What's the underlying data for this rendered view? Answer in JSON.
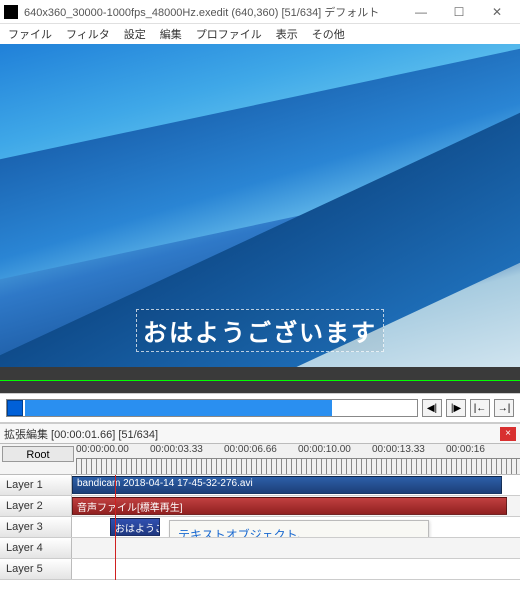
{
  "titlebar": {
    "title": "640x360_30000-1000fps_48000Hz.exedit (640,360) [51/634] デフォルト",
    "min": "—",
    "max": "☐",
    "close": "✕"
  },
  "menubar": [
    "ファイル",
    "フィルタ",
    "設定",
    "編集",
    "プロファイル",
    "表示",
    "その他"
  ],
  "preview_text": "おはようございます",
  "nav": {
    "a": "◀|",
    "b": "|▶",
    "c": "|←",
    "d": "→|"
  },
  "timeline": {
    "title": "拡張編集 [00:00:01.66] [51/634]",
    "close": "×",
    "root": "Root",
    "ticks": [
      "00:00:00.00",
      "00:00:03.33",
      "00:00:06.66",
      "00:00:10.00",
      "00:00:13.33",
      "00:00:16"
    ],
    "layers": [
      "Layer 1",
      "Layer 2",
      "Layer 3",
      "Layer 4",
      "Layer 5"
    ],
    "clip_video": "bandicam 2018-04-14 17-45-32-276.avi",
    "clip_audio": "音声ファイル[標準再生]",
    "clip_text": "おはようご"
  },
  "callout": "テキストオブジェクト、\nまたはその付近に赤色の線を\n移動する"
}
